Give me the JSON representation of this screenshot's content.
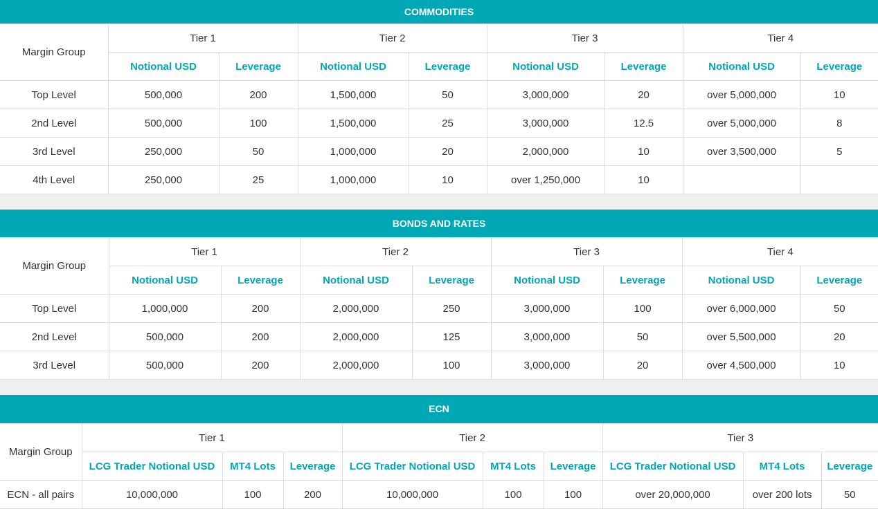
{
  "commodities": {
    "title": "COMMODITIES",
    "margin_group_label": "Margin Group",
    "tiers": [
      "Tier 1",
      "Tier 2",
      "Tier 3",
      "Tier 4"
    ],
    "sub_headers": [
      "Notional USD",
      "Leverage",
      "Notional USD",
      "Leverage",
      "Notional USD",
      "Leverage",
      "Notional USD",
      "Leverage"
    ],
    "rows": [
      [
        "Top Level",
        "500,000",
        "200",
        "1,500,000",
        "50",
        "3,000,000",
        "20",
        "over 5,000,000",
        "10"
      ],
      [
        "2nd Level",
        "500,000",
        "100",
        "1,500,000",
        "25",
        "3,000,000",
        "12.5",
        "over 5,000,000",
        "8"
      ],
      [
        "3rd Level",
        "250,000",
        "50",
        "1,000,000",
        "20",
        "2,000,000",
        "10",
        "over 3,500,000",
        "5"
      ],
      [
        "4th Level",
        "250,000",
        "25",
        "1,000,000",
        "10",
        "over 1,250,000",
        "10",
        "",
        ""
      ]
    ]
  },
  "bonds": {
    "title": "BONDS AND RATES",
    "margin_group_label": "Margin Group",
    "tiers": [
      "Tier 1",
      "Tier 2",
      "Tier 3",
      "Tier 4"
    ],
    "sub_headers": [
      "Notional USD",
      "Leverage",
      "Notional USD",
      "Leverage",
      "Notional USD",
      "Leverage",
      "Notional USD",
      "Leverage"
    ],
    "rows": [
      [
        "Top Level",
        "1,000,000",
        "200",
        "2,000,000",
        "250",
        "3,000,000",
        "100",
        "over 6,000,000",
        "50"
      ],
      [
        "2nd Level",
        "500,000",
        "200",
        "2,000,000",
        "125",
        "3,000,000",
        "50",
        "over 5,500,000",
        "20"
      ],
      [
        "3rd Level",
        "500,000",
        "200",
        "2,000,000",
        "100",
        "3,000,000",
        "20",
        "over 4,500,000",
        "10"
      ]
    ]
  },
  "ecn": {
    "title": "ECN",
    "margin_group_label": "Margin Group",
    "tiers": [
      "Tier 1",
      "Tier 2",
      "Tier 3"
    ],
    "sub_headers": [
      "LCG Trader Notional USD",
      "MT4 Lots",
      "Leverage",
      "LCG Trader Notional USD",
      "MT4 Lots",
      "Leverage",
      "LCG Trader Notional USD",
      "MT4 Lots",
      "Leverage"
    ],
    "rows": [
      [
        "ECN - all pairs",
        "10,000,000",
        "100",
        "200",
        "10,000,000",
        "100",
        "100",
        "over 20,000,000",
        "over 200 lots",
        "50"
      ]
    ]
  },
  "colors": {
    "accent": "#00a8b5",
    "header_text": "#ffffff",
    "body_text": "#333333",
    "border": "#dcdcdc",
    "page_background": "#efefef"
  }
}
